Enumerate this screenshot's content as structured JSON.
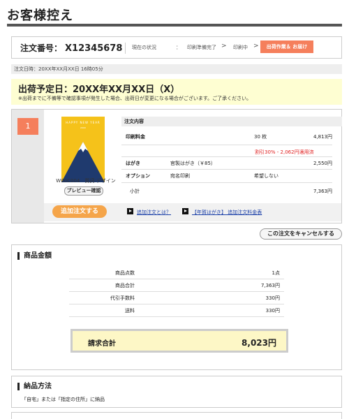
{
  "page": {
    "title": "お客様控え"
  },
  "order": {
    "number_label": "注文番号：",
    "number": "X12345678",
    "status_label": "現在の状況",
    "status_colon": "：",
    "steps": [
      "印刷準備完了",
      "印刷中",
      "出荷作業＆ お届け"
    ],
    "arrow": ">",
    "current_step_index": 2,
    "order_datetime": "注文日時：20XX年XX月XX日 16時05分"
  },
  "shipping": {
    "title": "出荷予定日：20XX年XX月XX日（X）",
    "note": "※出荷までに不備等で確認事項が発生した場合、出荷日が変更になる場合がございます。ご了承ください。"
  },
  "item": {
    "index": "1",
    "card_text": "HAPPY NEW YEAR",
    "card_sub": "20XX",
    "design_caption": "W00C004　賀詞:デザイン",
    "preview_label": "プレビュー確認",
    "detail_header": "注文内容",
    "rows": [
      {
        "label": "印刷料金",
        "mid": "30 枚",
        "value": "4,813円"
      },
      {
        "label": "はがき",
        "mid": "官製はがき（￥85）",
        "value": "2,550円"
      },
      {
        "label": "オプション",
        "mid": "宛名印刷",
        "value": "希望しない"
      },
      {
        "label": "小計",
        "mid": "",
        "value": "7,363円"
      }
    ],
    "discount": "割引30% - 2,062円適用済",
    "add_order_label": "追加注文する",
    "link1": "追加注文とは？",
    "link2": "【年賀はがき】 追加注文料金表"
  },
  "cancel_label": "この注文をキャンセルする",
  "amount": {
    "title": "商品金額",
    "rows": [
      {
        "label": "商品点数",
        "value": "1点"
      },
      {
        "label": "商品合計",
        "value": "7,363円"
      },
      {
        "label": "代引手数料",
        "value": "330円"
      },
      {
        "label": "送料",
        "value": "330円"
      }
    ],
    "total_label": "請求合計",
    "total_value": "8,023円"
  },
  "delivery": {
    "title": "納品方法",
    "text": "「自宅」または「指定の住所」に納品"
  },
  "colors": {
    "accent": "#f57f5c",
    "add_button": "#f5a54a",
    "highlight": "#fefed2",
    "total_bg": "#fdf7c6",
    "card": "#f5c21a",
    "mountain": "#1f3a6e"
  }
}
